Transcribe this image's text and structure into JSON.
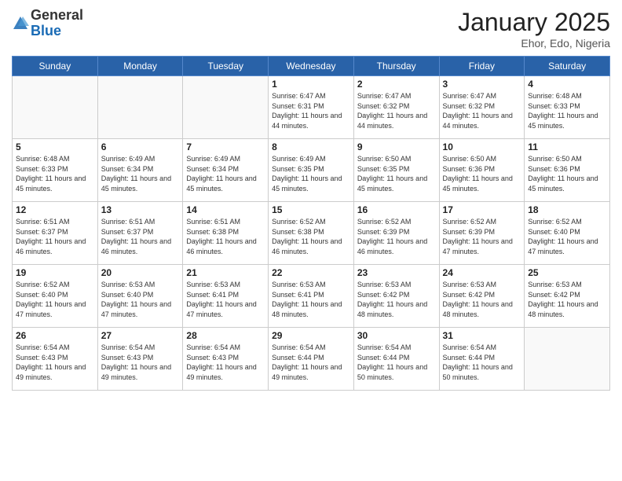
{
  "header": {
    "logo_general": "General",
    "logo_blue": "Blue",
    "month_title": "January 2025",
    "location": "Ehor, Edo, Nigeria"
  },
  "days_of_week": [
    "Sunday",
    "Monday",
    "Tuesday",
    "Wednesday",
    "Thursday",
    "Friday",
    "Saturday"
  ],
  "weeks": [
    [
      {
        "day": "",
        "empty": true
      },
      {
        "day": "",
        "empty": true
      },
      {
        "day": "",
        "empty": true
      },
      {
        "day": "1",
        "sunrise": "6:47 AM",
        "sunset": "6:31 PM",
        "daylight": "11 hours and 44 minutes."
      },
      {
        "day": "2",
        "sunrise": "6:47 AM",
        "sunset": "6:32 PM",
        "daylight": "11 hours and 44 minutes."
      },
      {
        "day": "3",
        "sunrise": "6:47 AM",
        "sunset": "6:32 PM",
        "daylight": "11 hours and 44 minutes."
      },
      {
        "day": "4",
        "sunrise": "6:48 AM",
        "sunset": "6:33 PM",
        "daylight": "11 hours and 45 minutes."
      }
    ],
    [
      {
        "day": "5",
        "sunrise": "6:48 AM",
        "sunset": "6:33 PM",
        "daylight": "11 hours and 45 minutes."
      },
      {
        "day": "6",
        "sunrise": "6:49 AM",
        "sunset": "6:34 PM",
        "daylight": "11 hours and 45 minutes."
      },
      {
        "day": "7",
        "sunrise": "6:49 AM",
        "sunset": "6:34 PM",
        "daylight": "11 hours and 45 minutes."
      },
      {
        "day": "8",
        "sunrise": "6:49 AM",
        "sunset": "6:35 PM",
        "daylight": "11 hours and 45 minutes."
      },
      {
        "day": "9",
        "sunrise": "6:50 AM",
        "sunset": "6:35 PM",
        "daylight": "11 hours and 45 minutes."
      },
      {
        "day": "10",
        "sunrise": "6:50 AM",
        "sunset": "6:36 PM",
        "daylight": "11 hours and 45 minutes."
      },
      {
        "day": "11",
        "sunrise": "6:50 AM",
        "sunset": "6:36 PM",
        "daylight": "11 hours and 45 minutes."
      }
    ],
    [
      {
        "day": "12",
        "sunrise": "6:51 AM",
        "sunset": "6:37 PM",
        "daylight": "11 hours and 46 minutes."
      },
      {
        "day": "13",
        "sunrise": "6:51 AM",
        "sunset": "6:37 PM",
        "daylight": "11 hours and 46 minutes."
      },
      {
        "day": "14",
        "sunrise": "6:51 AM",
        "sunset": "6:38 PM",
        "daylight": "11 hours and 46 minutes."
      },
      {
        "day": "15",
        "sunrise": "6:52 AM",
        "sunset": "6:38 PM",
        "daylight": "11 hours and 46 minutes."
      },
      {
        "day": "16",
        "sunrise": "6:52 AM",
        "sunset": "6:39 PM",
        "daylight": "11 hours and 46 minutes."
      },
      {
        "day": "17",
        "sunrise": "6:52 AM",
        "sunset": "6:39 PM",
        "daylight": "11 hours and 47 minutes."
      },
      {
        "day": "18",
        "sunrise": "6:52 AM",
        "sunset": "6:40 PM",
        "daylight": "11 hours and 47 minutes."
      }
    ],
    [
      {
        "day": "19",
        "sunrise": "6:52 AM",
        "sunset": "6:40 PM",
        "daylight": "11 hours and 47 minutes."
      },
      {
        "day": "20",
        "sunrise": "6:53 AM",
        "sunset": "6:40 PM",
        "daylight": "11 hours and 47 minutes."
      },
      {
        "day": "21",
        "sunrise": "6:53 AM",
        "sunset": "6:41 PM",
        "daylight": "11 hours and 47 minutes."
      },
      {
        "day": "22",
        "sunrise": "6:53 AM",
        "sunset": "6:41 PM",
        "daylight": "11 hours and 48 minutes."
      },
      {
        "day": "23",
        "sunrise": "6:53 AM",
        "sunset": "6:42 PM",
        "daylight": "11 hours and 48 minutes."
      },
      {
        "day": "24",
        "sunrise": "6:53 AM",
        "sunset": "6:42 PM",
        "daylight": "11 hours and 48 minutes."
      },
      {
        "day": "25",
        "sunrise": "6:53 AM",
        "sunset": "6:42 PM",
        "daylight": "11 hours and 48 minutes."
      }
    ],
    [
      {
        "day": "26",
        "sunrise": "6:54 AM",
        "sunset": "6:43 PM",
        "daylight": "11 hours and 49 minutes."
      },
      {
        "day": "27",
        "sunrise": "6:54 AM",
        "sunset": "6:43 PM",
        "daylight": "11 hours and 49 minutes."
      },
      {
        "day": "28",
        "sunrise": "6:54 AM",
        "sunset": "6:43 PM",
        "daylight": "11 hours and 49 minutes."
      },
      {
        "day": "29",
        "sunrise": "6:54 AM",
        "sunset": "6:44 PM",
        "daylight": "11 hours and 49 minutes."
      },
      {
        "day": "30",
        "sunrise": "6:54 AM",
        "sunset": "6:44 PM",
        "daylight": "11 hours and 50 minutes."
      },
      {
        "day": "31",
        "sunrise": "6:54 AM",
        "sunset": "6:44 PM",
        "daylight": "11 hours and 50 minutes."
      },
      {
        "day": "",
        "empty": true
      }
    ]
  ]
}
